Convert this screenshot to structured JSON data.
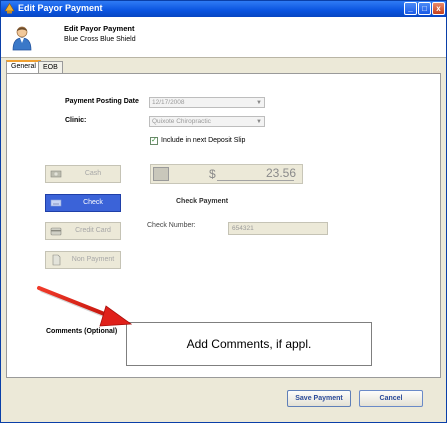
{
  "window": {
    "title": "Edit Payor Payment",
    "buttons": {
      "minimize": "_",
      "maximize": "□",
      "close": "x"
    }
  },
  "header": {
    "title": "Edit Payor Payment",
    "subtitle": "Blue Cross Blue Shield",
    "icon": "user-icon"
  },
  "tabs": [
    {
      "label": "General",
      "active": true
    },
    {
      "label": "EOB",
      "active": false
    }
  ],
  "form": {
    "posting_date_label": "Payment Posting Date",
    "posting_date_value": "12/17/2008",
    "clinic_label": "Clinic:",
    "clinic_value": "Quixote Chiropractic",
    "deposit_checkbox_label": "Include in next Deposit Slip",
    "deposit_checked": true
  },
  "payment_methods": [
    {
      "label": "Cash",
      "icon": "cash-icon",
      "selected": false
    },
    {
      "label": "Check",
      "icon": "check-icon",
      "selected": true
    },
    {
      "label": "Credit Card",
      "icon": "credit-card-icon",
      "selected": false
    },
    {
      "label": "Non Payment",
      "icon": "document-icon",
      "selected": false
    }
  ],
  "amount": {
    "currency": "$",
    "value": "23.56"
  },
  "check_payment": {
    "heading": "Check Payment",
    "check_number_label": "Check Number:",
    "check_number_value": "654321"
  },
  "comments": {
    "label": "Comments (Optional)",
    "value": "Add Comments, if appl."
  },
  "footer": {
    "save_label": "Save Payment",
    "cancel_label": "Cancel"
  },
  "colors": {
    "titlebar": "#0a54e0",
    "selected_button": "#3b63d8",
    "annotation_arrow": "#e0201a"
  }
}
